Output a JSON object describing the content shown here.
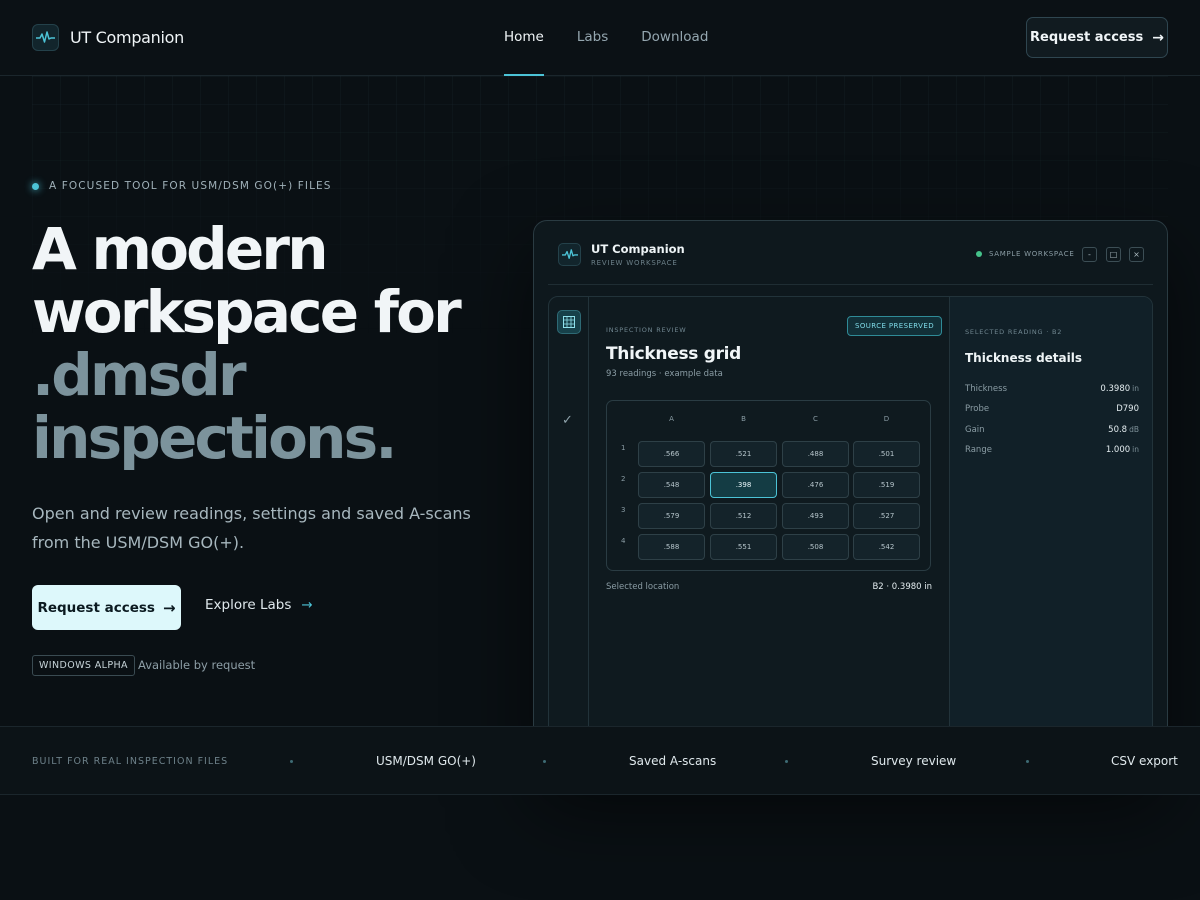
{
  "header": {
    "brand": "UT Companion",
    "nav": [
      "Home",
      "Labs",
      "Download"
    ],
    "active_nav": "Home",
    "cta": "Request access",
    "cta_icon": "arrow-right-icon"
  },
  "hero": {
    "eyebrow": "A FOCUSED TOOL FOR USM/DSM GO(+) FILES",
    "headline_line1": "A modern",
    "headline_line2": "workspace for",
    "headline_muted1": ".dmsdr",
    "headline_muted2": "inspections.",
    "subcopy": "Open and review readings, settings and saved A-scans from the USM/DSM GO(+).",
    "primary_button": "Request access",
    "secondary_button": "Explore Labs",
    "badge": "WINDOWS ALPHA",
    "availability": "Available by request"
  },
  "app_window": {
    "title": "UT Companion",
    "subtitle": "REVIEW WORKSPACE",
    "status": "SAMPLE WORKSPACE",
    "controls": [
      "-",
      "□",
      "×"
    ],
    "section_label": "INSPECTION REVIEW",
    "source_badge": "SOURCE PRESERVED",
    "grid_title": "Thickness grid",
    "grid_subtitle": "93 readings · example data",
    "columns": [
      "A",
      "B",
      "C",
      "D"
    ],
    "rows": [
      {
        "label": "1",
        "values": [
          ".566",
          ".521",
          ".488",
          ".501"
        ]
      },
      {
        "label": "2",
        "values": [
          ".548",
          ".398",
          ".476",
          ".519"
        ]
      },
      {
        "label": "3",
        "values": [
          ".579",
          ".512",
          ".493",
          ".527"
        ]
      },
      {
        "label": "4",
        "values": [
          ".588",
          ".551",
          ".508",
          ".542"
        ]
      }
    ],
    "selected_cell": "B2",
    "selected_location_label": "Selected location",
    "selected_location_value": "B2 · 0.3980 in",
    "details": {
      "section_label": "SELECTED READING · B2",
      "title": "Thickness details",
      "rows": [
        {
          "key": "Thickness",
          "value": "0.3980",
          "unit": "in"
        },
        {
          "key": "Probe",
          "value": "D790",
          "unit": ""
        },
        {
          "key": "Gain",
          "value": "50.8",
          "unit": "dB"
        },
        {
          "key": "Range",
          "value": "1.000",
          "unit": "in"
        }
      ]
    }
  },
  "strip": {
    "label": "BUILT FOR REAL INSPECTION FILES",
    "items": [
      "USM/DSM GO(+)",
      "Saved A-scans",
      "Survey review",
      "CSV export"
    ]
  },
  "colors": {
    "background": "#0a1014",
    "accent": "#4cc3d6",
    "primary_button_bg": "#ddf8fb",
    "status_green": "#45c28a"
  }
}
